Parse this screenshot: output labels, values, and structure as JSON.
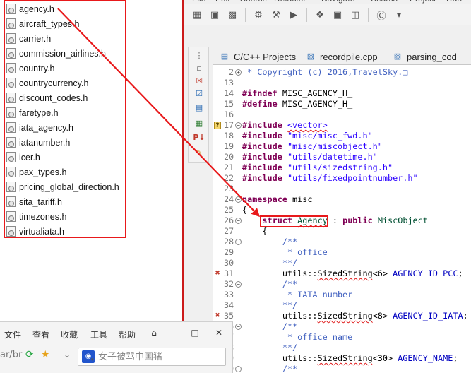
{
  "file_list": {
    "files": [
      "agency.h",
      "aircraft_types.h",
      "carrier.h",
      "commission_airlines.h",
      "country.h",
      "countrycurrency.h",
      "discount_codes.h",
      "faretype.h",
      "iata_agency.h",
      "iatanumber.h",
      "icer.h",
      "pax_types.h",
      "pricing_global_direction.h",
      "sita_tariff.h",
      "timezones.h",
      "virtualiata.h"
    ]
  },
  "ide": {
    "menu": [
      "File",
      "Edit",
      "Source",
      "Refactor",
      "Navigate",
      "Search",
      "Project",
      "Run"
    ],
    "tabs": [
      {
        "label": "C/C++ Projects",
        "icon": "cpp-projects-icon"
      },
      {
        "label": "recordpile.cpp",
        "icon": "cpp-file-icon"
      },
      {
        "label": "parsing_cod",
        "icon": "cpp-file-icon"
      }
    ],
    "editor": {
      "lines": [
        {
          "n": "2",
          "fold": "+",
          "html": "<span class=\"cmdoc\"> * Copyright (c) 2016,TravelSky.</span><span class=\"cmdoc\">&#9633;</span>"
        },
        {
          "n": "13",
          "html": ""
        },
        {
          "n": "14",
          "html": "<span class=\"kw\">#ifndef</span> MISC_AGENCY_H_"
        },
        {
          "n": "15",
          "html": "<span class=\"kw\">#define</span> MISC_AGENCY_H_"
        },
        {
          "n": "16",
          "html": ""
        },
        {
          "n": "17",
          "fold": "-",
          "marker": "?",
          "html": "<span class=\"kw\">#include</span> <span class=\"str squig\">&lt;vector&gt;</span>"
        },
        {
          "n": "18",
          "html": "<span class=\"kw\">#include</span> <span class=\"str\">\"misc/misc_fwd.h\"</span>"
        },
        {
          "n": "19",
          "html": "<span class=\"kw\">#include</span> <span class=\"str\">\"misc/miscobject.h\"</span>"
        },
        {
          "n": "20",
          "html": "<span class=\"kw\">#include</span> <span class=\"str\">\"utils/datetime.h\"</span>"
        },
        {
          "n": "21",
          "html": "<span class=\"kw\">#include</span> <span class=\"str\">\"utils/sizedstring.h\"</span>"
        },
        {
          "n": "22",
          "html": "<span class=\"kw\">#include</span> <span class=\"str\">\"utils/fixedpointnumber.h\"</span>"
        },
        {
          "n": "23",
          "html": ""
        },
        {
          "n": "24",
          "fold": "-",
          "html": "<span class=\"kw\">namespace</span> misc"
        },
        {
          "n": "25",
          "html": "{"
        },
        {
          "n": "26",
          "fold": "-",
          "html": "    <span class=\"kw\">struct</span> <span class=\"ty squig\">Agency</span> : <span class=\"kw\">public</span> <span class=\"ty\">MiscObject</span>"
        },
        {
          "n": "27",
          "html": "    {"
        },
        {
          "n": "28",
          "fold": "-",
          "html": "        <span class=\"cmdoc\">/**</span>"
        },
        {
          "n": "29",
          "html": "<span class=\"cmdoc\">         * office</span>"
        },
        {
          "n": "30",
          "html": "<span class=\"cmdoc\">        **/</span>"
        },
        {
          "n": "31",
          "marker": "x",
          "html": "        utils::<span class=\"squig\">SizedString</span>&lt;6&gt; <span class=\"field\">AGENCY_ID_PCC</span>;"
        },
        {
          "n": "32",
          "fold": "-",
          "html": "        <span class=\"cmdoc\">/**</span>"
        },
        {
          "n": "33",
          "html": "<span class=\"cmdoc\">         * IATA number</span>"
        },
        {
          "n": "34",
          "html": "<span class=\"cmdoc\">        **/</span>"
        },
        {
          "n": "35",
          "marker": "x",
          "html": "        utils::<span class=\"squig\">SizedString</span>&lt;8&gt; <span class=\"field\">AGENCY_ID_IATA</span>;"
        },
        {
          "n": "36",
          "fold": "-",
          "html": "        <span class=\"cmdoc\">/**</span>"
        },
        {
          "n": "37",
          "html": "<span class=\"cmdoc\">         * office name</span>"
        },
        {
          "n": "38",
          "html": "<span class=\"cmdoc\">        **/</span>"
        },
        {
          "n": "39",
          "html": "        utils::<span class=\"squig\">SizedString</span>&lt;30&gt; <span class=\"field\">AGENCY_NAME</span>;"
        },
        {
          "n": "40",
          "fold": "-",
          "html": "        <span class=\"cmdoc\">/**</span>"
        }
      ]
    }
  },
  "browser": {
    "menu": [
      "文件",
      "查看",
      "收藏",
      "工具",
      "帮助"
    ],
    "address_fragment": "ar/br",
    "search_placeholder": "女子被骂中国猪"
  },
  "colors": {
    "annotation_red": "#e8191b",
    "keyword": "#7f0055",
    "string": "#2a00ff",
    "doc_comment": "#3f5fbf"
  }
}
